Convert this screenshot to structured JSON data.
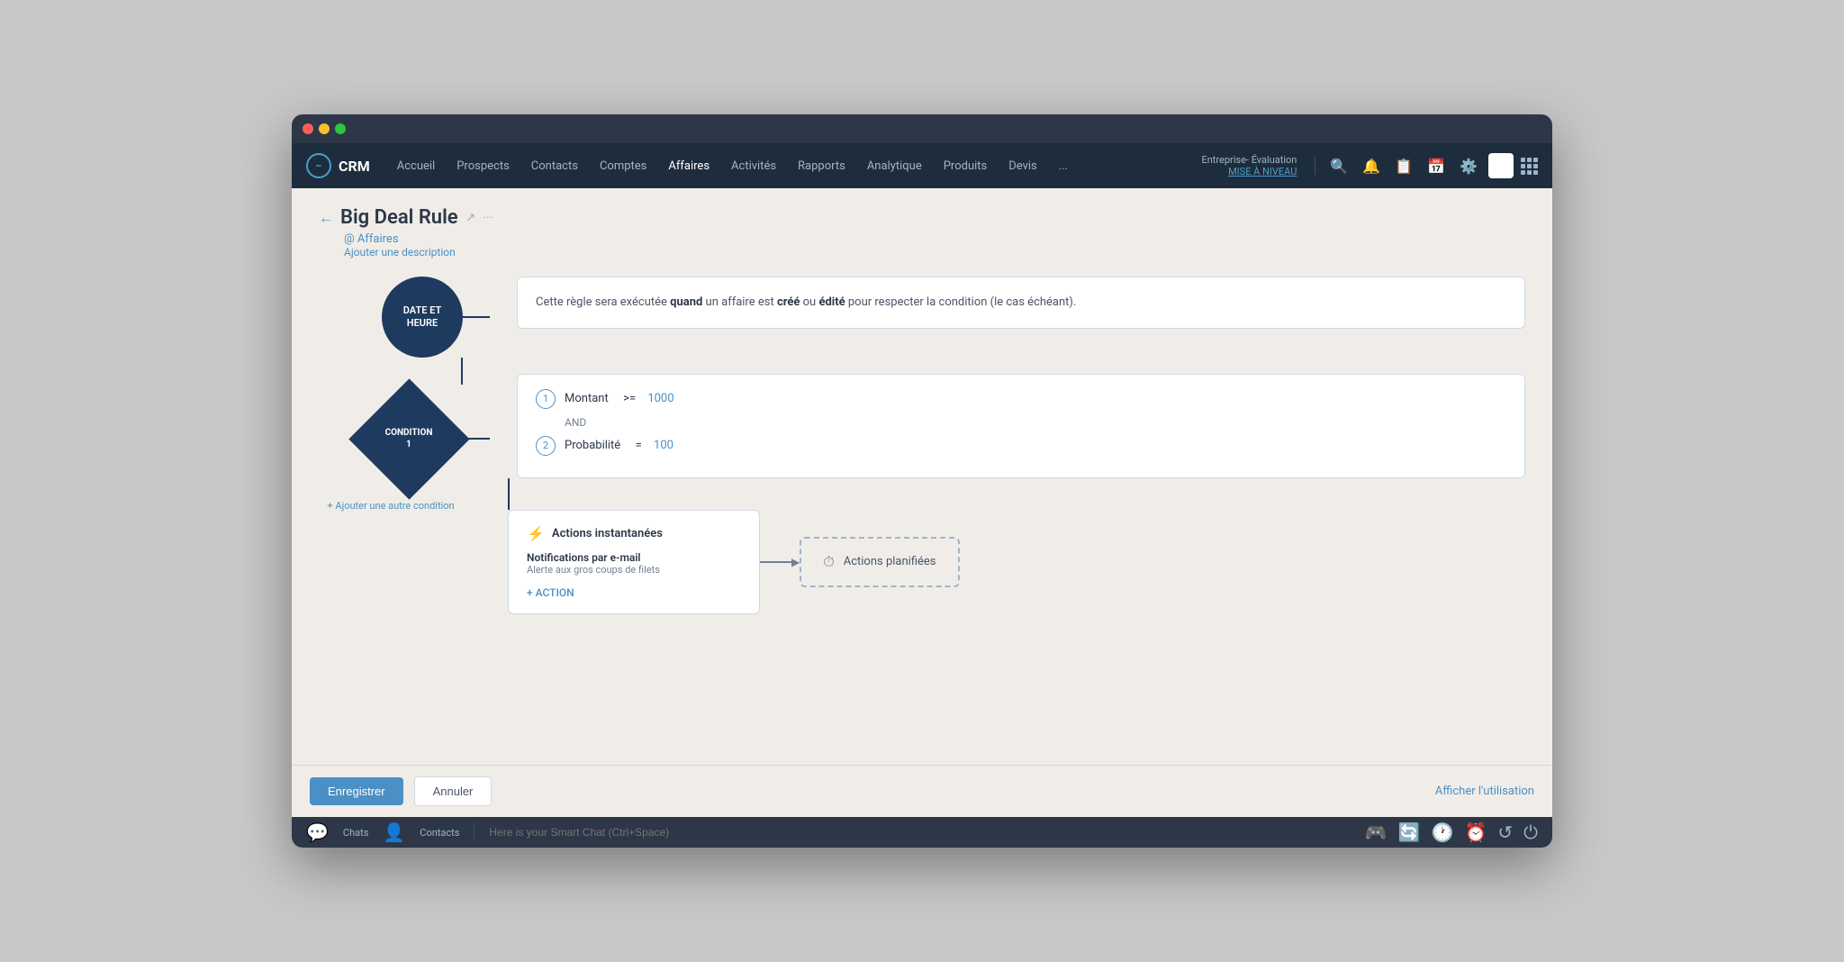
{
  "window": {
    "title": "Big Deal Rule"
  },
  "topnav": {
    "logo": "CRM",
    "items": [
      "Accueil",
      "Prospects",
      "Contacts",
      "Comptes",
      "Affaires",
      "Activités",
      "Rapports",
      "Analytique",
      "Produits",
      "Devis",
      "..."
    ],
    "enterprise": "Entreprise- Évaluation",
    "upgrade": "MISE À NIVEAU"
  },
  "page": {
    "back_label": "←",
    "title": "Big Deal Rule",
    "subtitle": "@ Affaires",
    "add_desc": "Ajouter une description"
  },
  "trigger_node": {
    "label": "DATE ET\nHEURE"
  },
  "condition_node": {
    "label": "CONDITION\n1"
  },
  "trigger_info": {
    "text_before": "Cette règle sera exécutée ",
    "keyword1": "quand",
    "text_mid1": " un affaire est ",
    "keyword2": "créé",
    "text_mid2": " ou ",
    "keyword3": "édité",
    "text_after": " pour respecter la condition (le cas échéant)."
  },
  "conditions": [
    {
      "num": "1",
      "field": "Montant",
      "operator": ">=",
      "value": "1000"
    },
    {
      "num": "2",
      "field": "Probabilité",
      "operator": "=",
      "value": "100"
    }
  ],
  "condition_and": "AND",
  "add_condition": "+ Ajouter une autre condition",
  "instant_actions": {
    "header": "Actions instantanées",
    "notification_title": "Notifications par e-mail",
    "notification_sub": "Alerte aux gros coups de filets",
    "add_action": "+ ACTION"
  },
  "planned_actions": {
    "label": "Actions planifiées"
  },
  "toolbar": {
    "save": "Enregistrer",
    "cancel": "Annuler",
    "show_usage": "Afficher l'utilisation"
  },
  "status_bar": {
    "placeholder": "Here is your Smart Chat (Ctrl+Space)",
    "tab1": "Chats",
    "tab2": "Contacts"
  }
}
